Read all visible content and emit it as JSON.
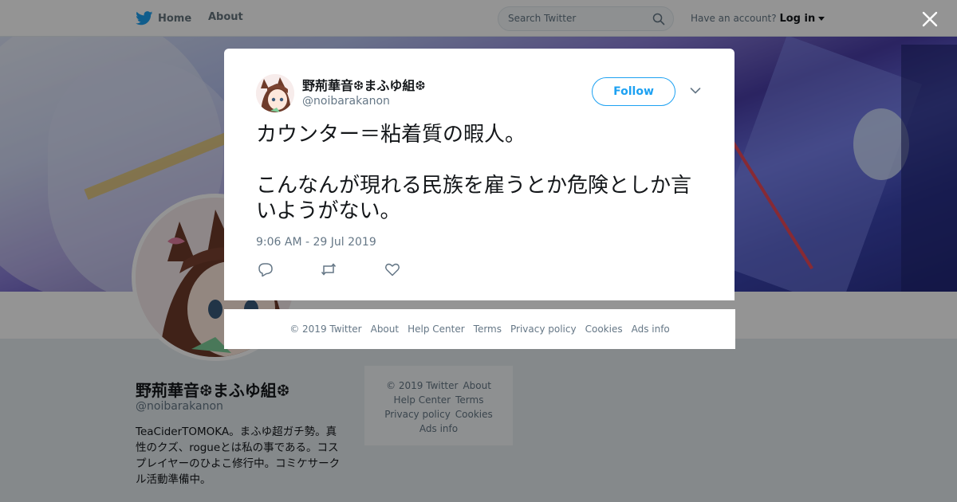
{
  "topbar": {
    "home_label": "Home",
    "about_label": "About",
    "search_placeholder": "Search Twitter",
    "account_prompt": "Have an account?",
    "login_label": "Log in"
  },
  "profile": {
    "name": "野荊華音❆まふゆ組❆",
    "handle": "@noibarakanon",
    "bio": "TeaCiderTOMOKA。まふゆ超ガチ勢。真性のクズ、rogueとは私の事である。コスプレイヤーのひよこ修行中。コミケサークル活動準備中。"
  },
  "side_footer": {
    "copyright": "© 2019 Twitter",
    "about": "About",
    "help": "Help Center",
    "terms": "Terms",
    "privacy": "Privacy policy",
    "cookies": "Cookies",
    "ads": "Ads info"
  },
  "tweet": {
    "author_name": "野荊華音❆まふゆ組❆",
    "author_handle": "@noibarakanon",
    "follow_label": "Follow",
    "text": "カウンター＝粘着質の暇人。\n\nこんなんが現れる民族を雇うとか危険としか言いようがない。",
    "timestamp": "9:06 AM - 29 Jul 2019"
  },
  "modal_footer": {
    "copyright": "© 2019 Twitter",
    "about": "About",
    "help": "Help Center",
    "terms": "Terms",
    "privacy": "Privacy policy",
    "cookies": "Cookies",
    "ads": "Ads info"
  },
  "colors": {
    "brand_blue": "#1da1f2",
    "text_primary": "#14171a",
    "text_secondary": "#657786"
  }
}
